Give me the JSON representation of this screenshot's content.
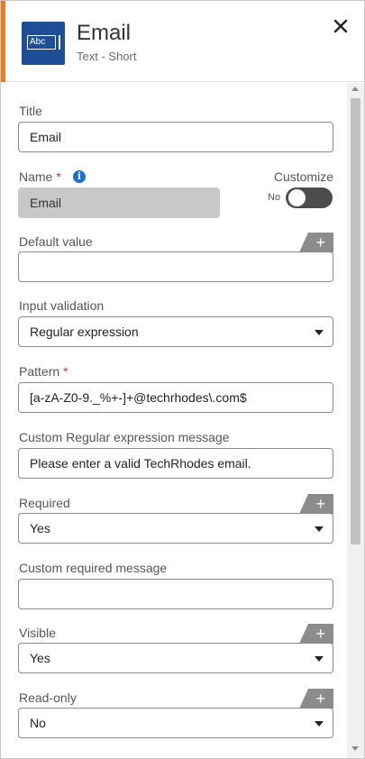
{
  "header": {
    "icon_text": "Abc",
    "title": "Email",
    "subtitle": "Text - Short",
    "close": "✕",
    "accent_color": "#e97d23",
    "icon_bg_color": "#1f4e96"
  },
  "fields": {
    "title": {
      "label": "Title",
      "value": "Email"
    },
    "name": {
      "label": "Name",
      "required_mark": "*",
      "info_icon": "i",
      "value": "Email"
    },
    "customize": {
      "label": "Customize",
      "toggle_state_text": "No"
    },
    "default_value": {
      "label": "Default value",
      "value": "",
      "add": "+"
    },
    "input_validation": {
      "label": "Input validation",
      "selected": "Regular expression"
    },
    "pattern": {
      "label": "Pattern",
      "required_mark": "*",
      "value": "[a-zA-Z0-9._%+-]+@techrhodes\\.com$"
    },
    "custom_regex_message": {
      "label": "Custom Regular expression message",
      "value": "Please enter a valid TechRhodes email."
    },
    "required": {
      "label": "Required",
      "selected": "Yes",
      "add": "+"
    },
    "custom_required_message": {
      "label": "Custom required message",
      "value": ""
    },
    "visible": {
      "label": "Visible",
      "selected": "Yes",
      "add": "+"
    },
    "read_only": {
      "label": "Read-only",
      "selected": "No",
      "add": "+"
    }
  }
}
